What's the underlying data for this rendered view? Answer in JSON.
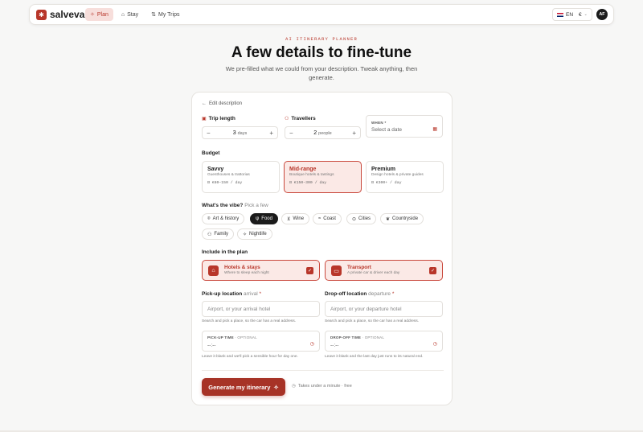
{
  "nav": {
    "brand": "salveva",
    "tabs": [
      {
        "label": "Plan",
        "icon": "sparkle-icon",
        "active": true
      },
      {
        "label": "Stay",
        "icon": "bed-icon",
        "active": false
      },
      {
        "label": "My Trips",
        "icon": "route-icon",
        "active": false
      }
    ],
    "lang": "EN",
    "currency": "€",
    "avatar": "AF"
  },
  "hero": {
    "eyebrow": "AI ITINERARY PLANNER",
    "title": "A few details to fine-tune",
    "subtitle": "We pre-filled what we could from your description. Tweak anything, then generate."
  },
  "form": {
    "edit_link": "Edit description",
    "trip_length": {
      "label": "Trip length",
      "value": "3",
      "unit": "days"
    },
    "travellers": {
      "label": "Travellers",
      "value": "2",
      "unit": "people"
    },
    "when": {
      "label": "WHEN *",
      "placeholder": "Select a date"
    },
    "budget_label": "Budget",
    "budgets": [
      {
        "title": "Savvy",
        "desc": "Guesthouses & trattorias",
        "price": "€80–150 / day",
        "selected": false
      },
      {
        "title": "Mid-range",
        "desc": "Boutique hotels & tastings",
        "price": "€150–300 / day",
        "selected": true
      },
      {
        "title": "Premium",
        "desc": "Design hotels & private guides",
        "price": "€300+ / day",
        "selected": false
      }
    ],
    "vibe_label": "What's the vibe?",
    "vibe_hint": "Pick a few",
    "vibes": [
      {
        "label": "Art & history",
        "selected": false
      },
      {
        "label": "Food",
        "selected": true
      },
      {
        "label": "Wine",
        "selected": false
      },
      {
        "label": "Coast",
        "selected": false
      },
      {
        "label": "Cities",
        "selected": false
      },
      {
        "label": "Countryside",
        "selected": false
      },
      {
        "label": "Family",
        "selected": false
      },
      {
        "label": "Nightlife",
        "selected": false
      }
    ],
    "include_label": "Include in the plan",
    "includes": [
      {
        "title": "Hotels & stays",
        "desc": "Where to sleep each night",
        "checked": true
      },
      {
        "title": "Transport",
        "desc": "A private car & driver each day",
        "checked": true
      }
    ],
    "pickup": {
      "label": "Pick-up location",
      "modifier": "arrival",
      "placeholder": "Airport, or your arrival hotel",
      "hint": "Search and pick a place, so the car has a real address.",
      "time_label": "PICK-UP TIME",
      "time_optional": "· OPTIONAL",
      "time_value": "--:--",
      "time_hint": "Leave it blank and we'll pick a sensible hour for day one."
    },
    "dropoff": {
      "label": "Drop-off location",
      "modifier": "departure",
      "placeholder": "Airport, or your departure hotel",
      "hint": "Search and pick a place, so the car has a real address.",
      "time_label": "DROP-OFF TIME",
      "time_optional": "· OPTIONAL",
      "time_value": "--:--",
      "time_hint": "Leave it blank and the last day just runs to its natural end."
    },
    "generate_label": "Generate my itinerary",
    "generate_note": "Takes under a minute · free"
  },
  "colors": {
    "accent": "#b8362a",
    "accent_bg": "#fbe9e6",
    "dark": "#1b1b1b"
  }
}
